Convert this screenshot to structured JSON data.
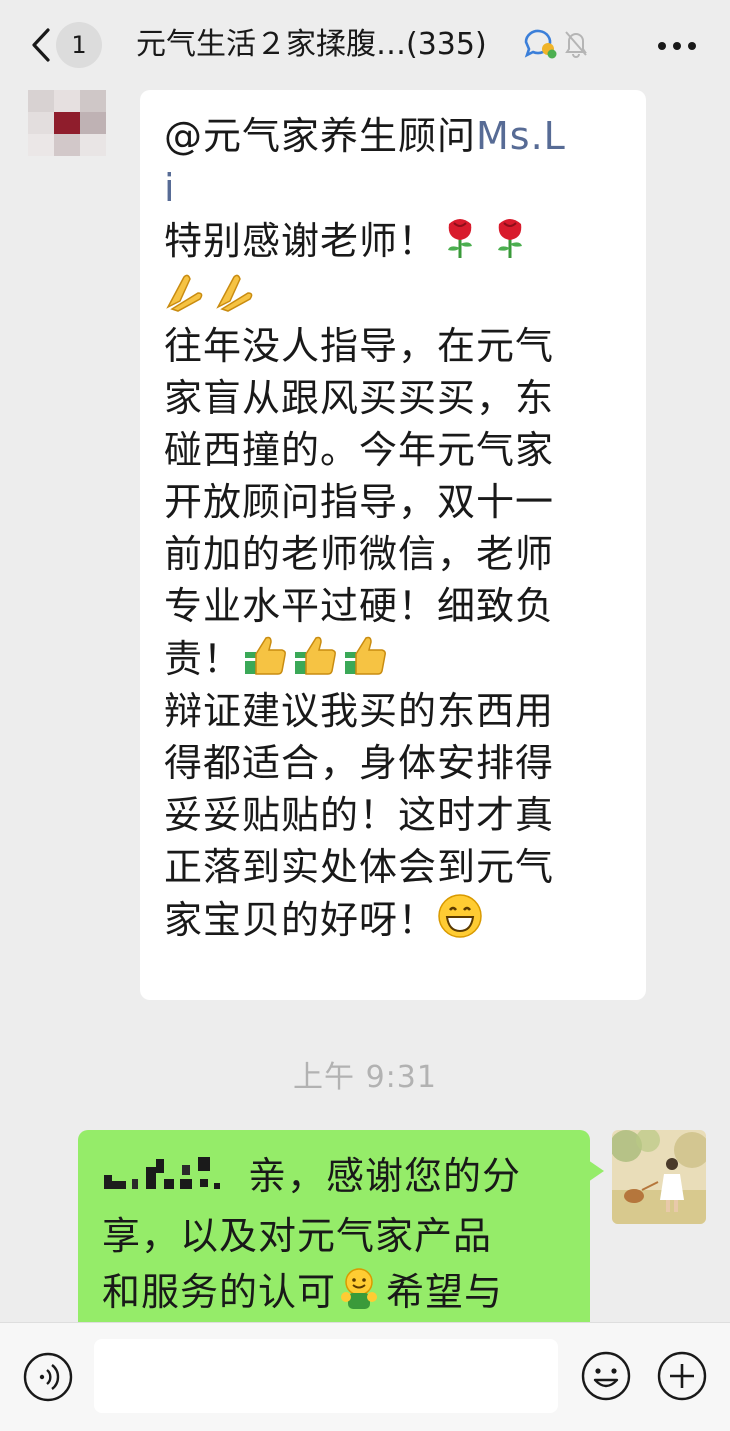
{
  "header": {
    "unread_count": "1",
    "title": "元气生活２家揉腹…",
    "member_count": "(335)"
  },
  "incoming": {
    "mention_cn": "@元气家养生顾问",
    "mention_en": "Ms.L",
    "mention_en_wrap": "i",
    "line_thanks": "特别感谢老师！",
    "body_lines_1": [
      "往年没人指导，在元气",
      "家盲从跟风买买买，东",
      "碰西撞的。今年元气家",
      "开放顾问指导，双十一",
      "前加的老师微信，老师",
      "专业水平过硬！细致负"
    ],
    "line_responsible": "责！",
    "body_lines_2": [
      "辩证建议我买的东西用",
      "得都适合，身体安排得",
      "妥妥贴贴的！这时才真",
      "正落到实处体会到元气"
    ],
    "line_last": "家宝贝的好呀！",
    "emoji_rose": "rose-emoji",
    "emoji_pray": "folded-hands-emoji",
    "emoji_thumbs": "thumbs-up-emoji",
    "emoji_grin": "grinning-emoji"
  },
  "timestamp": "上午 9:31",
  "outgoing": {
    "line_1": "亲，感谢您的分",
    "line_2": "享，以及对元气家产品",
    "line_3a": "和服务的认可",
    "line_3b": "希望与",
    "emoji_hug": "hugging-emoji"
  },
  "input": {
    "placeholder": ""
  },
  "colors": {
    "background": "#ededed",
    "incoming_bubble": "#ffffff",
    "outgoing_bubble": "#95ec69",
    "timestamp": "#b2b2b2"
  }
}
